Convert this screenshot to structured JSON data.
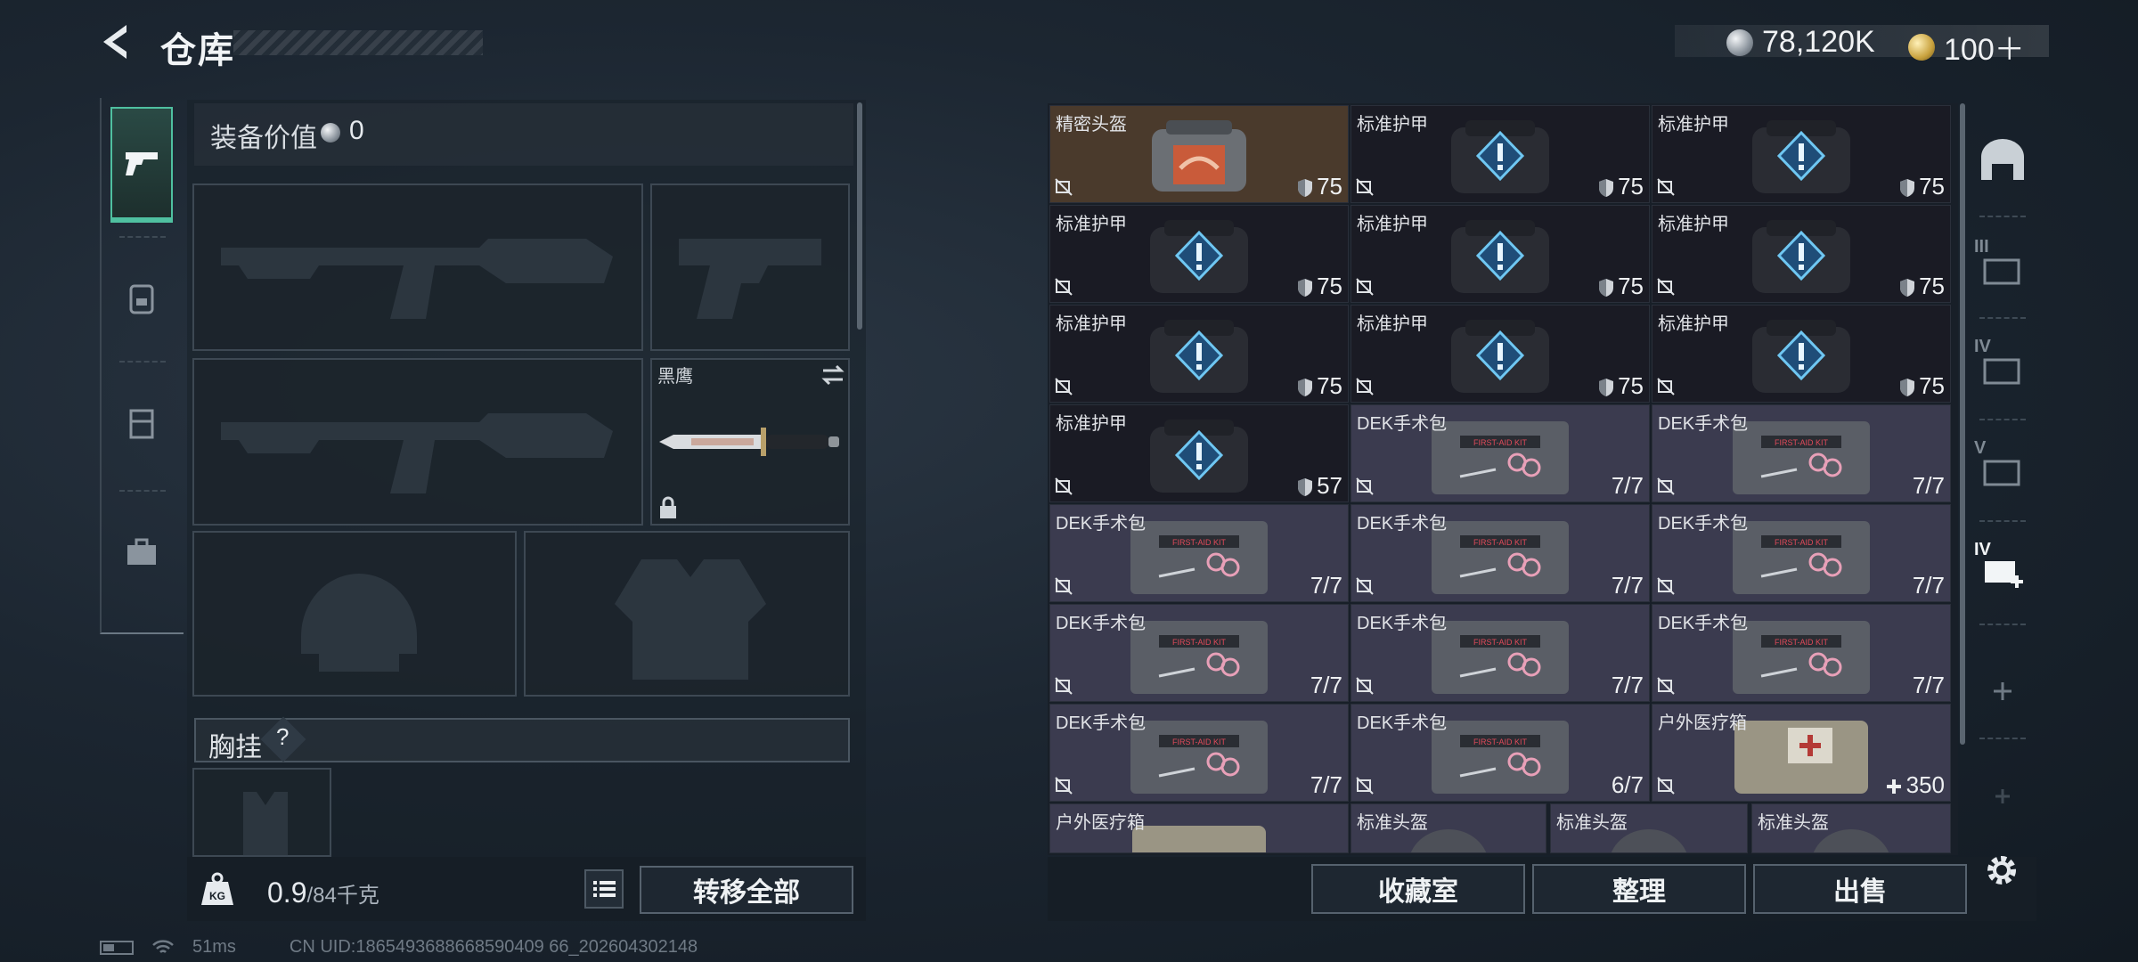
{
  "header": {
    "title": "仓库",
    "currencies": [
      {
        "icon": "silver-coin-icon",
        "value": "78,120K"
      },
      {
        "icon": "gold-coin-icon",
        "value": "100＋"
      }
    ]
  },
  "loadout": {
    "equip_value_label": "装备价值",
    "equip_value": "0",
    "knife_name": "黑鹰",
    "chest_label": "胸挂",
    "chest_help": "?"
  },
  "bottom_left": {
    "weight_current": "0.9",
    "weight_capacity": "/84千克",
    "transfer_all_label": "转移全部"
  },
  "status": {
    "ping": "51ms",
    "uid": "CN UID:1865493688668590409 66_202604302148"
  },
  "inventory": {
    "items": [
      {
        "name": "精密头盔",
        "kind": "helmet-rare",
        "value": "75",
        "value_type": "durability"
      },
      {
        "name": "标准护甲",
        "kind": "armor",
        "value": "75",
        "value_type": "durability"
      },
      {
        "name": "标准护甲",
        "kind": "armor",
        "value": "75",
        "value_type": "durability"
      },
      {
        "name": "标准护甲",
        "kind": "armor",
        "value": "75",
        "value_type": "durability"
      },
      {
        "name": "标准护甲",
        "kind": "armor",
        "value": "75",
        "value_type": "durability"
      },
      {
        "name": "标准护甲",
        "kind": "armor",
        "value": "75",
        "value_type": "durability"
      },
      {
        "name": "标准护甲",
        "kind": "armor",
        "value": "75",
        "value_type": "durability"
      },
      {
        "name": "标准护甲",
        "kind": "armor",
        "value": "75",
        "value_type": "durability"
      },
      {
        "name": "标准护甲",
        "kind": "armor",
        "value": "75",
        "value_type": "durability"
      },
      {
        "name": "标准护甲",
        "kind": "armor",
        "value": "57",
        "value_type": "durability"
      },
      {
        "name": "DEK手术包",
        "kind": "kit",
        "value": "7/7",
        "value_type": "uses"
      },
      {
        "name": "DEK手术包",
        "kind": "kit",
        "value": "7/7",
        "value_type": "uses"
      },
      {
        "name": "DEK手术包",
        "kind": "kit",
        "value": "7/7",
        "value_type": "uses"
      },
      {
        "name": "DEK手术包",
        "kind": "kit",
        "value": "7/7",
        "value_type": "uses"
      },
      {
        "name": "DEK手术包",
        "kind": "kit",
        "value": "7/7",
        "value_type": "uses"
      },
      {
        "name": "DEK手术包",
        "kind": "kit",
        "value": "7/7",
        "value_type": "uses"
      },
      {
        "name": "DEK手术包",
        "kind": "kit",
        "value": "7/7",
        "value_type": "uses"
      },
      {
        "name": "DEK手术包",
        "kind": "kit",
        "value": "7/7",
        "value_type": "uses"
      },
      {
        "name": "DEK手术包",
        "kind": "kit",
        "value": "7/7",
        "value_type": "uses"
      },
      {
        "name": "DEK手术包",
        "kind": "kit",
        "value": "6/7",
        "value_type": "uses"
      },
      {
        "name": "户外医疗箱",
        "kind": "outdoor",
        "value": "350",
        "value_type": "heal"
      }
    ],
    "partial_row": [
      "户外医疗箱",
      "标准头盔",
      "标准头盔",
      "标准头盔"
    ]
  },
  "bottom_right": {
    "collection_label": "收藏室",
    "sort_label": "整理",
    "sell_label": "出售"
  },
  "right_tabs": [
    "III",
    "IV",
    "V",
    "IV"
  ],
  "colors": {
    "accent": "#4fc0a0",
    "armor_bg": "#1a1b24",
    "kit_bg": "#3b3b4f",
    "rare_bg": "#4a3a2c",
    "diamond_blue": "#2f8fd6"
  }
}
